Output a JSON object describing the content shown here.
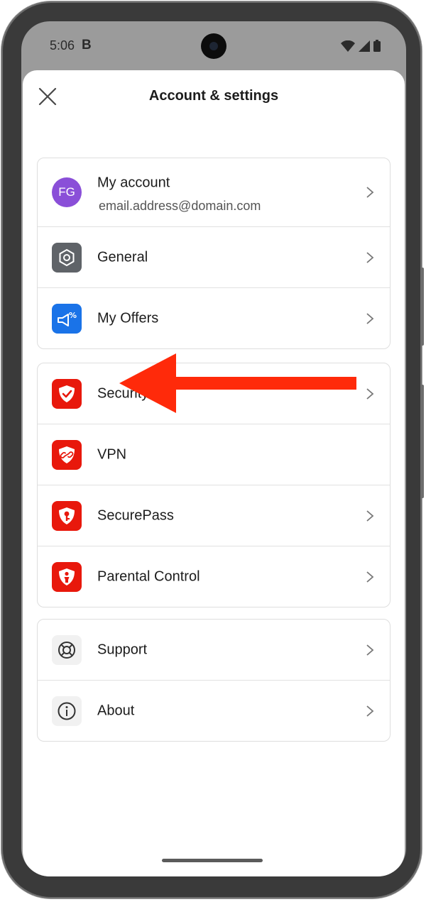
{
  "status_bar": {
    "time": "5:06",
    "notification_letter": "B",
    "icons": [
      "wifi-icon",
      "signal-icon",
      "battery-icon"
    ]
  },
  "header": {
    "title": "Account & settings",
    "close_icon": "close-icon"
  },
  "account": {
    "initials": "FG",
    "label": "My account",
    "email": "email.address@domain.com",
    "avatar_color": "#8a4fd8"
  },
  "groups": [
    {
      "items": [
        {
          "label": "General",
          "icon": "hexagon-settings-icon",
          "icon_bg": "#5f6368"
        },
        {
          "label": "My Offers",
          "icon": "megaphone-percent-icon",
          "icon_bg": "#1a73e8"
        }
      ]
    },
    {
      "items": [
        {
          "label": "Security",
          "icon": "shield-check-icon",
          "icon_bg": "#e8180c"
        },
        {
          "label": "VPN",
          "icon": "shield-link-icon",
          "icon_bg": "#e8180c"
        },
        {
          "label": "SecurePass",
          "icon": "shield-key-icon",
          "icon_bg": "#e8180c"
        },
        {
          "label": "Parental Control",
          "icon": "shield-person-icon",
          "icon_bg": "#e8180c"
        }
      ]
    },
    {
      "items": [
        {
          "label": "Support",
          "icon": "lifebuoy-icon",
          "icon_bg": "#f1f1f1"
        },
        {
          "label": "About",
          "icon": "info-icon",
          "icon_bg": "#f1f1f1"
        }
      ]
    }
  ],
  "annotation": {
    "arrow_icon": "red-arrow-pointer-icon",
    "arrow_color": "#ff2a0a"
  }
}
